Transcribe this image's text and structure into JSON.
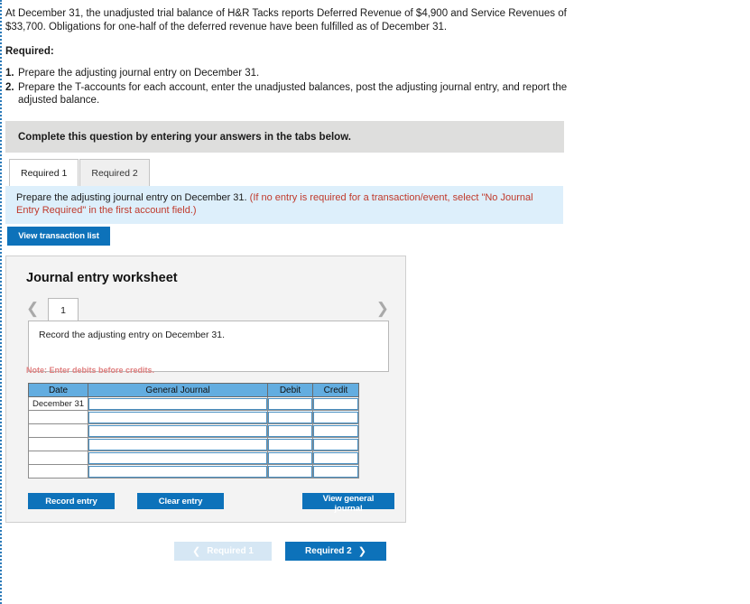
{
  "stem": {
    "paragraph": "At December 31, the unadjusted trial balance of H&R Tacks reports Deferred Revenue of $4,900 and Service Revenues of $33,700. Obligations for one-half of the deferred revenue have been fulfilled as of December 31.",
    "required_label": "Required:",
    "requirements": [
      {
        "num": "1.",
        "text": "Prepare the adjusting journal entry on December 31."
      },
      {
        "num": "2.",
        "text": "Prepare the T-accounts for each account, enter the unadjusted balances, post the adjusting journal entry, and report the adjusted balance."
      }
    ]
  },
  "complete_bar": {
    "text": "Complete this question by entering your answers in the tabs below."
  },
  "tabs": [
    {
      "label": "Required 1",
      "active": true
    },
    {
      "label": "Required 2",
      "active": false
    }
  ],
  "req_banner": {
    "main": "Prepare the adjusting journal entry on December 31. ",
    "note": "(If no entry is required for a transaction/event, select \"No Journal Entry Required\" in the first account field.)"
  },
  "view_transaction_list_label": "View transaction list",
  "worksheet": {
    "title": "Journal entry worksheet",
    "page_number": "1",
    "prev_icon": "chevron-left-icon",
    "next_icon": "chevron-right-icon",
    "record_prompt": "Record the adjusting entry on December 31.",
    "note": "Note: Enter debits before credits.",
    "table": {
      "headers": [
        "Date",
        "General Journal",
        "Debit",
        "Credit"
      ],
      "rows": [
        {
          "date": "December 31",
          "general_journal": "",
          "debit": "",
          "credit": ""
        },
        {
          "date": "",
          "general_journal": "",
          "debit": "",
          "credit": ""
        },
        {
          "date": "",
          "general_journal": "",
          "debit": "",
          "credit": ""
        },
        {
          "date": "",
          "general_journal": "",
          "debit": "",
          "credit": ""
        },
        {
          "date": "",
          "general_journal": "",
          "debit": "",
          "credit": ""
        },
        {
          "date": "",
          "general_journal": "",
          "debit": "",
          "credit": ""
        }
      ]
    },
    "buttons": {
      "record_entry": "Record entry",
      "clear_entry": "Clear entry",
      "view_general_journal": "View general journal"
    }
  },
  "bottom_nav": {
    "prev_label": "Required 1",
    "next_label": "Required 2",
    "prev_icon": "chevron-left-icon",
    "next_icon": "chevron-right-icon"
  },
  "colors": {
    "primary_blue": "#0d72ba",
    "table_header_blue": "#63ade0",
    "banner_blue": "#ddeffb",
    "gray_bar": "#dededd",
    "panel_gray": "#f3f3f3",
    "note_red": "#e08080",
    "parenthetical_red": "#c0392b",
    "disabled_nav_blue": "#d6e7f4"
  }
}
